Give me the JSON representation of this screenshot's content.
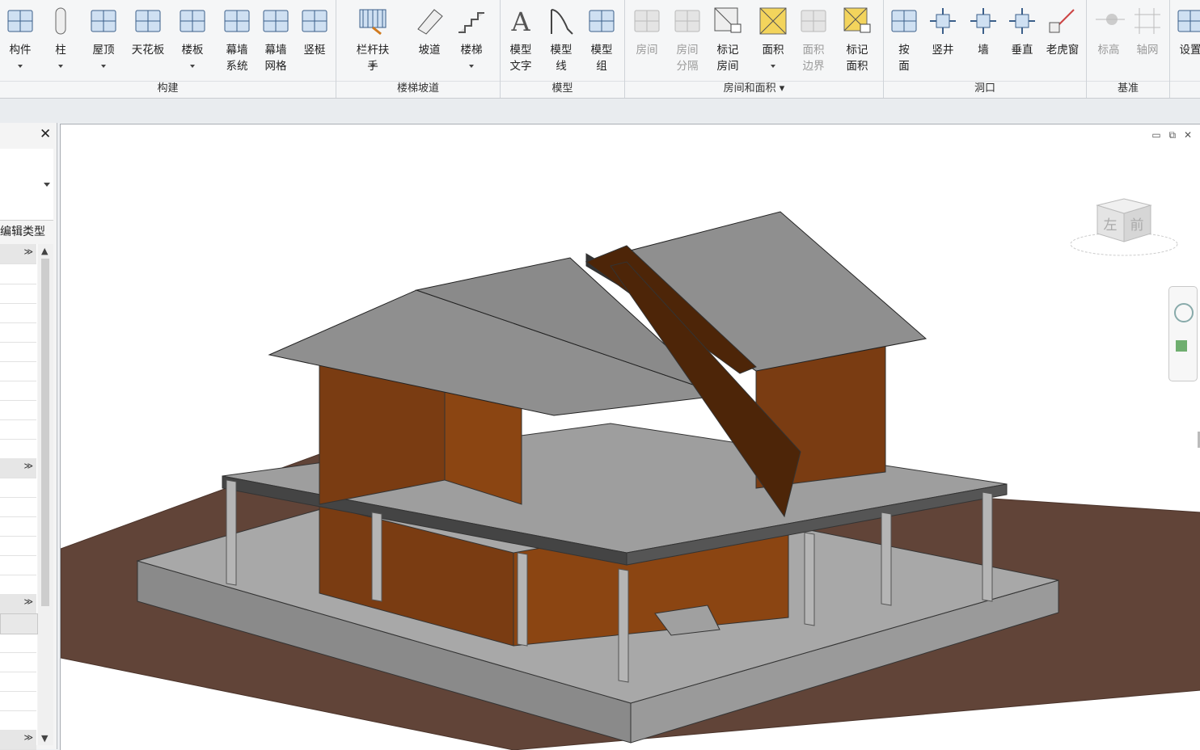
{
  "ribbon": {
    "groups": [
      {
        "label": "构建",
        "tools": [
          {
            "label": "构件",
            "icon": "component-icon",
            "dropdown": true
          },
          {
            "label": "柱",
            "icon": "column-icon",
            "dropdown": true
          },
          {
            "label": "屋顶",
            "icon": "roof-icon",
            "dropdown": true
          },
          {
            "label": "天花板",
            "icon": "ceiling-icon"
          },
          {
            "label": "楼板",
            "icon": "floor-icon",
            "dropdown": true
          },
          {
            "label": "幕墙\n系统",
            "icon": "curtain-system-icon"
          },
          {
            "label": "幕墙\n网格",
            "icon": "curtain-grid-icon"
          },
          {
            "label": "竖梃",
            "icon": "mullion-icon"
          }
        ]
      },
      {
        "label": "楼梯坡道",
        "tools": [
          {
            "label": "栏杆扶手",
            "icon": "railing-icon",
            "dropdown": true
          },
          {
            "label": "坡道",
            "icon": "ramp-icon"
          },
          {
            "label": "楼梯",
            "icon": "stair-icon",
            "dropdown": true
          }
        ]
      },
      {
        "label": "模型",
        "tools": [
          {
            "label": "模型\n文字",
            "icon": "model-text-icon"
          },
          {
            "label": "模型\n线",
            "icon": "model-line-icon"
          },
          {
            "label": "模型\n组",
            "icon": "model-group-icon"
          }
        ]
      },
      {
        "label": "房间和面积 ▾",
        "tools": [
          {
            "label": "房间",
            "icon": "room-icon",
            "disabled": true
          },
          {
            "label": "房间\n分隔",
            "icon": "room-separator-icon",
            "disabled": true
          },
          {
            "label": "标记\n房间",
            "icon": "tag-room-icon"
          },
          {
            "label": "面积",
            "icon": "area-icon",
            "dropdown": true
          },
          {
            "label": "面积\n边界",
            "icon": "area-boundary-icon",
            "disabled": true
          },
          {
            "label": "标记\n面积",
            "icon": "tag-area-icon"
          }
        ]
      },
      {
        "label": "洞口",
        "tools": [
          {
            "label": "按\n面",
            "icon": "by-face-icon"
          },
          {
            "label": "竖井",
            "icon": "shaft-icon"
          },
          {
            "label": "墙",
            "icon": "wall-opening-icon"
          },
          {
            "label": "垂直",
            "icon": "vertical-opening-icon"
          },
          {
            "label": "老虎窗",
            "icon": "dormer-icon"
          }
        ]
      },
      {
        "label": "基准",
        "tools": [
          {
            "label": "标高",
            "icon": "level-icon",
            "disabled": true
          },
          {
            "label": "轴网",
            "icon": "grid-icon",
            "disabled": true
          }
        ]
      },
      {
        "label": "",
        "tools": [
          {
            "label": "设置",
            "icon": "set-workplane-icon"
          }
        ]
      }
    ]
  },
  "properties": {
    "close_glyph": "✕",
    "edit_type": "编辑类型",
    "section_glyph": "≫"
  },
  "view": {
    "window_controls": "▭ ⧉ ✕",
    "viewcube": {
      "face_left": "左",
      "face_front": "前"
    }
  },
  "colors": {
    "roof": "#8f8f8f",
    "wall": "#7a3c12",
    "wall_dark": "#4d2508",
    "slab": "#9c9c9c",
    "ground": "#614438",
    "brick": "#8a8a8a",
    "ribbon_bg": "#f5f6f7"
  }
}
